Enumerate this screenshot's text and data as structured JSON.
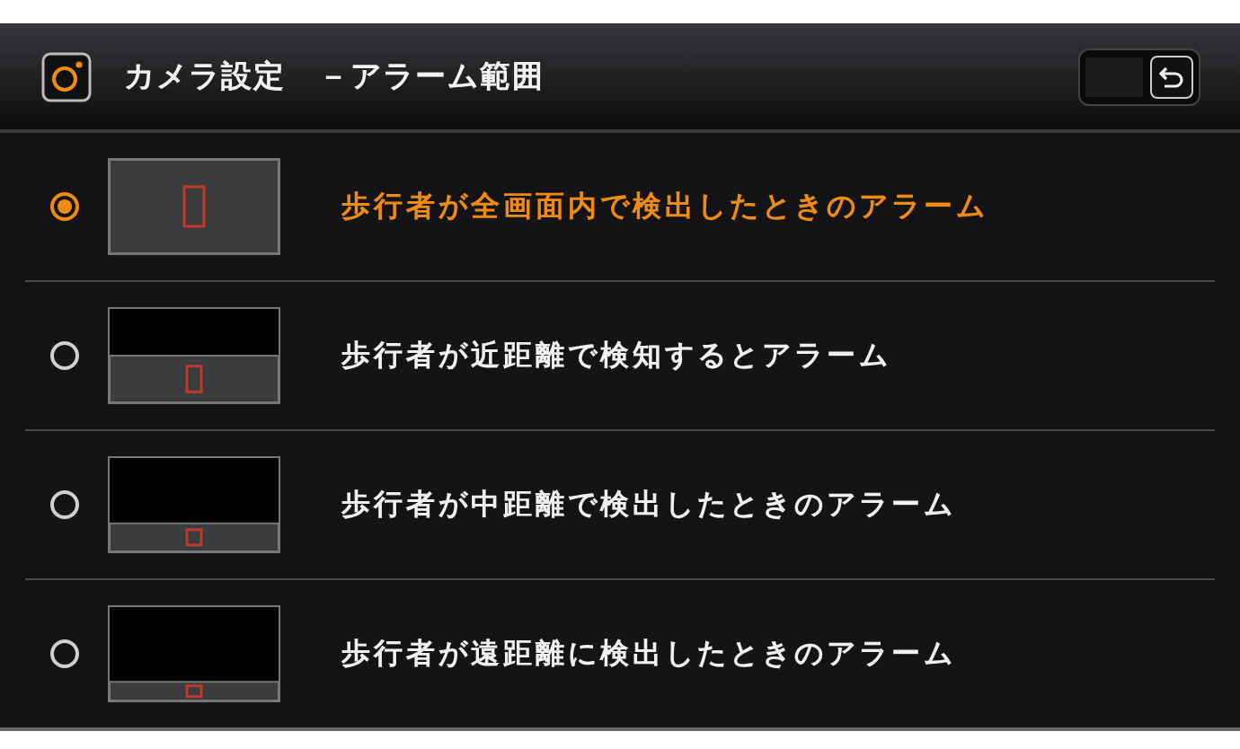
{
  "header": {
    "title": "カメラ設定　－アラーム範囲"
  },
  "options": [
    {
      "label": "歩行者が全画面内で検出したときのアラーム",
      "selected": true,
      "kind": "full"
    },
    {
      "label": "歩行者が近距離で検知するとアラーム",
      "selected": false,
      "kind": "near"
    },
    {
      "label": "歩行者が中距離で検出したときのアラーム",
      "selected": false,
      "kind": "middle"
    },
    {
      "label": "歩行者が遠距離に検出したときのアラーム",
      "selected": false,
      "kind": "far"
    }
  ]
}
